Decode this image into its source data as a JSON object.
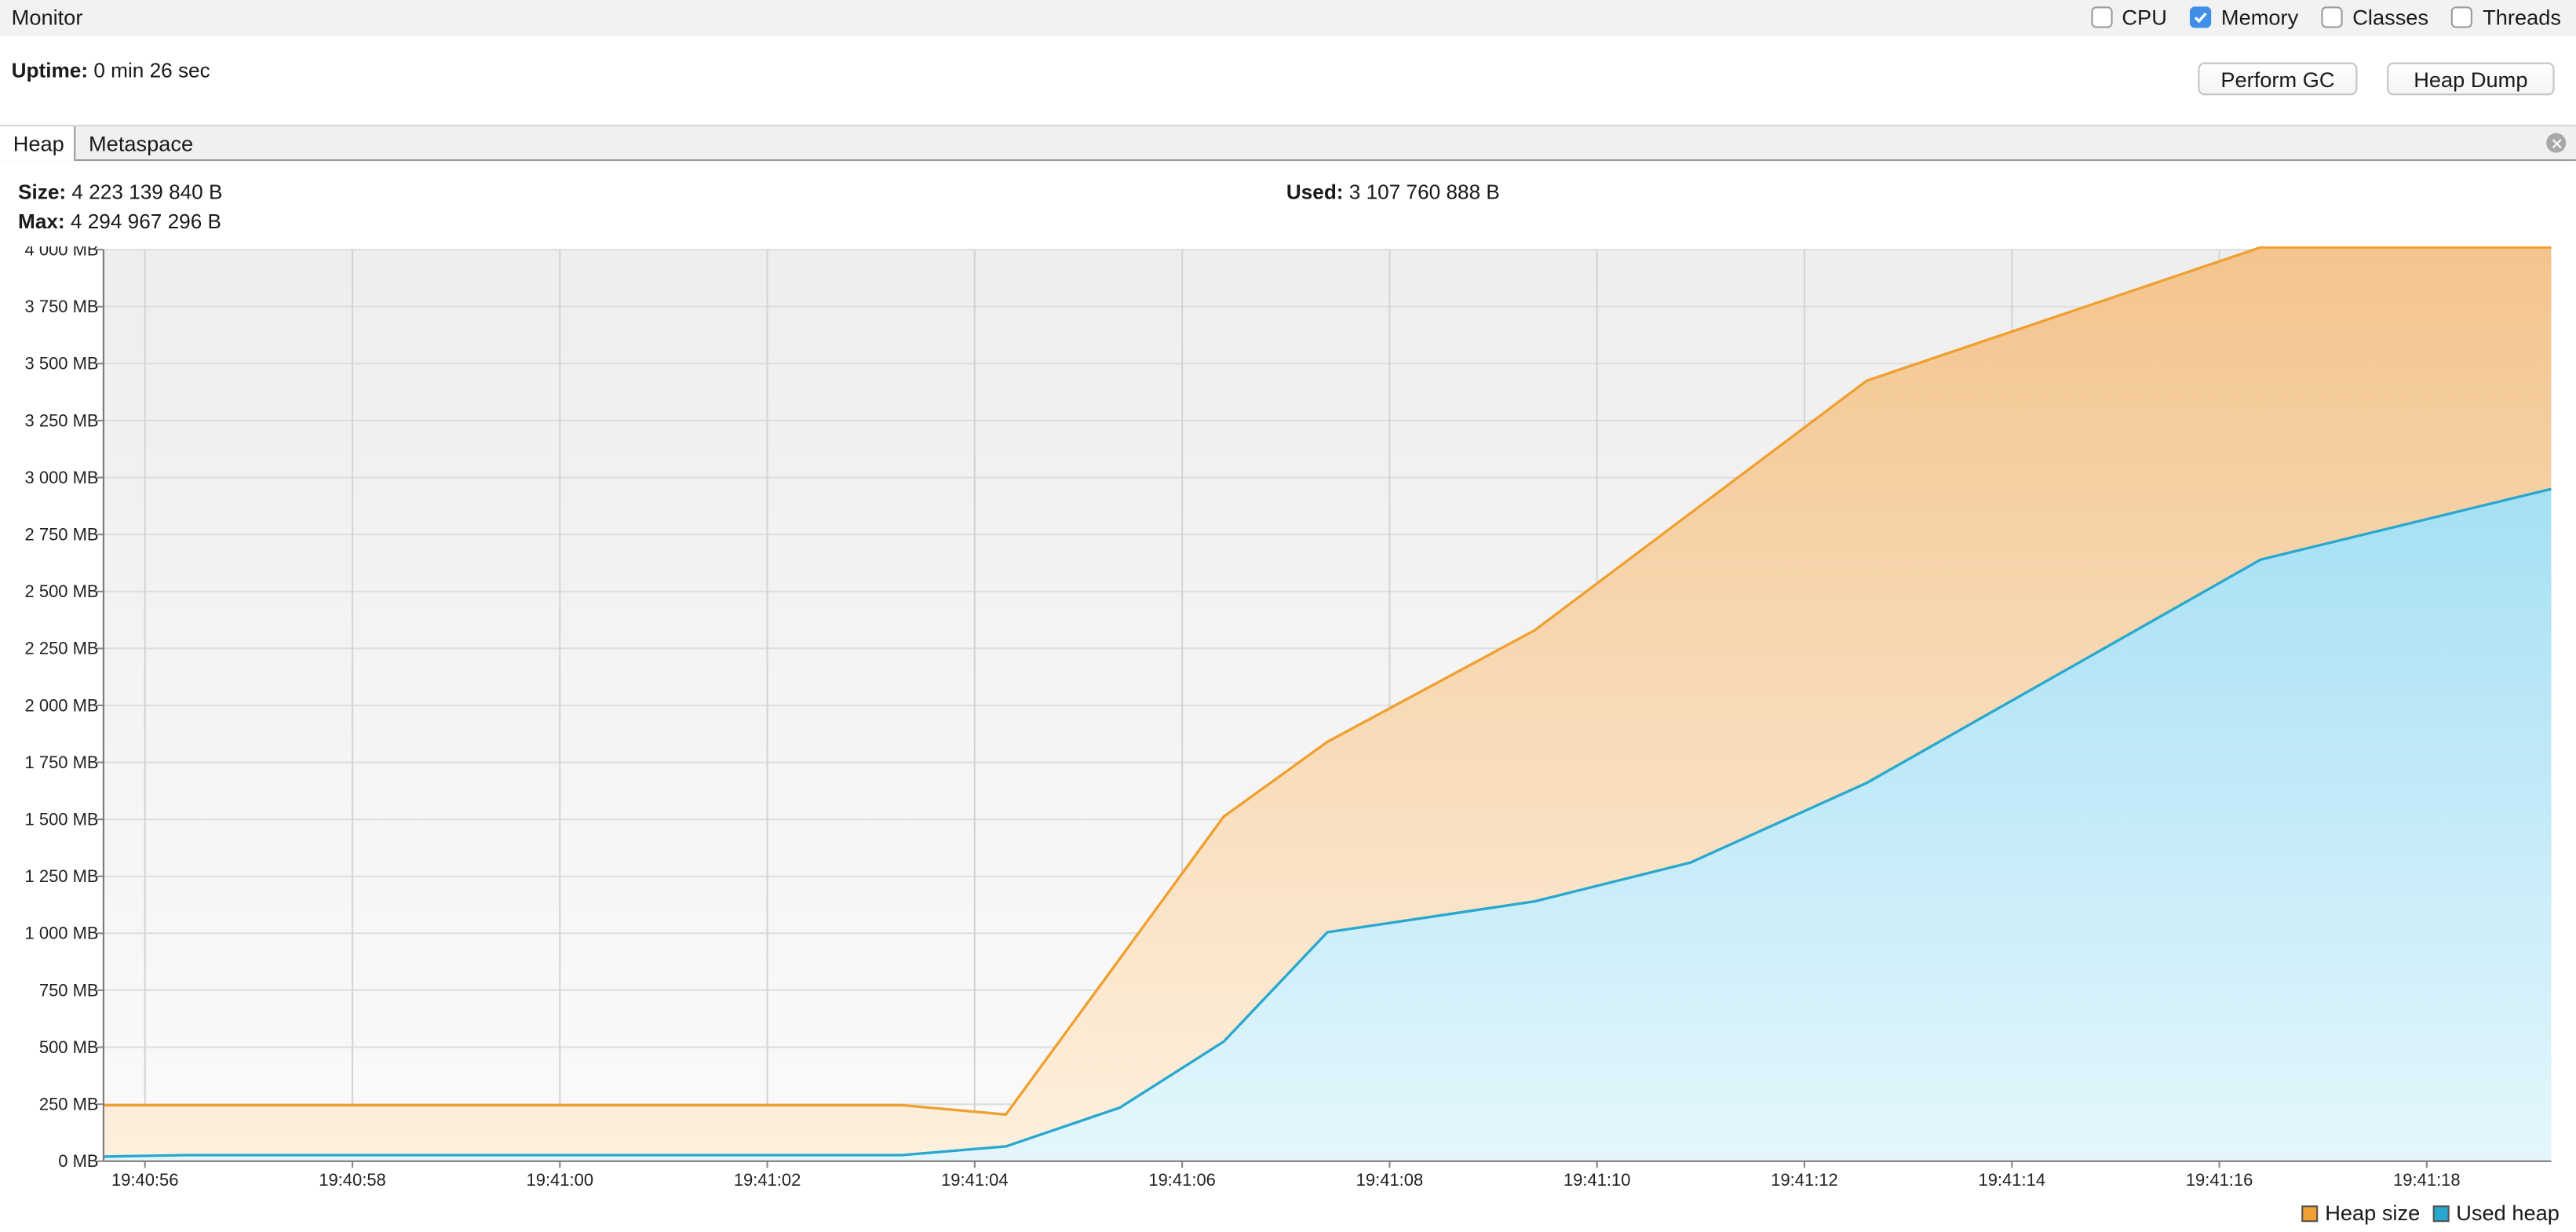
{
  "window": {
    "title": "Monitor"
  },
  "checkboxes": [
    {
      "label": "CPU",
      "checked": false
    },
    {
      "label": "Memory",
      "checked": true
    },
    {
      "label": "Classes",
      "checked": false
    },
    {
      "label": "Threads",
      "checked": false
    }
  ],
  "uptime": {
    "label": "Uptime:",
    "value": "0 min 26 sec"
  },
  "buttons": {
    "gc": "Perform GC",
    "heap_dump": "Heap Dump"
  },
  "tabs": [
    {
      "label": "Heap",
      "active": true
    },
    {
      "label": "Metaspace",
      "active": false
    }
  ],
  "stats": {
    "size_label": "Size:",
    "size_value": "4 223 139 840 B",
    "max_label": "Max:",
    "max_value": "4 294 967 296 B",
    "used_label": "Used:",
    "used_value": "3 107 760 888 B"
  },
  "colors": {
    "heap_size": "#f0a030",
    "used_heap": "#28a8d0",
    "accent": "#3f8ee8"
  },
  "chart_data": {
    "type": "area",
    "ylim": [
      0,
      4000
    ],
    "yticks": [
      0,
      250,
      500,
      750,
      1000,
      1250,
      1500,
      1750,
      2000,
      2250,
      2500,
      2750,
      3000,
      3250,
      3500,
      3750,
      4000
    ],
    "ytick_labels": [
      "0 MB",
      "250 MB",
      "500 MB",
      "750 MB",
      "1 000 MB",
      "1 250 MB",
      "1 500 MB",
      "1 750 MB",
      "2 000 MB",
      "2 250 MB",
      "2 500 MB",
      "2 750 MB",
      "3 000 MB",
      "3 250 MB",
      "3 500 MB",
      "3 750 MB",
      "4 000 MB"
    ],
    "xlim": [
      "19:40:55.6",
      "19:41:19.2"
    ],
    "xticks": [
      "19:40:56",
      "19:40:58",
      "19:41:00",
      "19:41:02",
      "19:41:04",
      "19:41:06",
      "19:41:08",
      "19:41:10",
      "19:41:12",
      "19:41:14",
      "19:41:16",
      "19:41:18"
    ],
    "legend_position": "bottom-right",
    "grid": true,
    "series": [
      {
        "name": "Heap size",
        "x": [
          "19:40:55.6",
          "19:41:03.3",
          "19:41:04.3",
          "19:41:06.4",
          "19:41:07.4",
          "19:41:09.4",
          "19:41:12.6",
          "19:41:16.4",
          "19:41:19.2"
        ],
        "values": [
          246,
          246,
          205,
          1512,
          1840,
          2330,
          3425,
          4010,
          4010
        ]
      },
      {
        "name": "Used heap",
        "x": [
          "19:40:55.6",
          "19:40:56.4",
          "19:41:03.3",
          "19:41:04.3",
          "19:41:05.4",
          "19:41:06.4",
          "19:41:07.4",
          "19:41:09.4",
          "19:41:10.9",
          "19:41:12.6",
          "19:41:16.4",
          "19:41:19.2"
        ],
        "values": [
          20,
          27,
          27,
          65,
          235,
          525,
          1005,
          1140,
          1310,
          1660,
          2640,
          2950
        ]
      }
    ]
  }
}
